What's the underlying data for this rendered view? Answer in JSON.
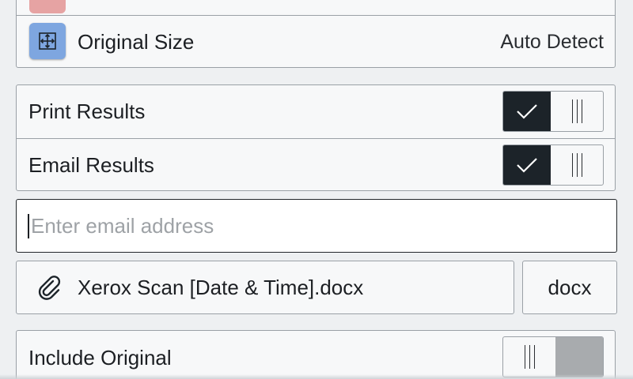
{
  "colors": {
    "icon_accent": "#7ea6e0",
    "toggle_on": "#1c2329",
    "toggle_off": "#a8abae",
    "peek_icon": "#e6a3a3"
  },
  "original_size": {
    "icon": "move-arrows-icon",
    "label": "Original Size",
    "value": "Auto Detect"
  },
  "print_results": {
    "label": "Print Results",
    "state": "on"
  },
  "email_results": {
    "label": "Email Results",
    "state": "on"
  },
  "email_input": {
    "placeholder": "Enter email address",
    "value": ""
  },
  "file": {
    "icon": "paperclip-icon",
    "name": "Xerox Scan [Date & Time].docx",
    "format": "docx"
  },
  "include_original": {
    "label": "Include Original",
    "state": "off"
  }
}
